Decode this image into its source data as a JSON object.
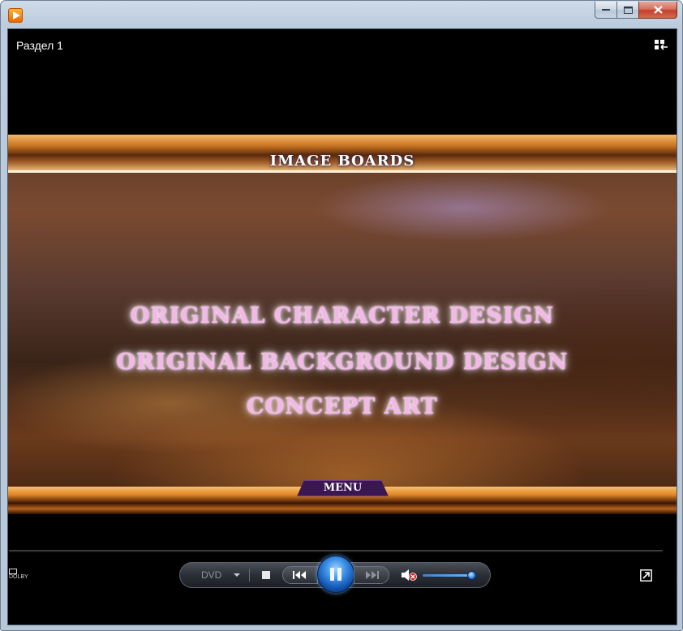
{
  "window": {
    "caption_buttons": [
      "minimize",
      "maximize",
      "close"
    ]
  },
  "header": {
    "chapter": "Раздел 1",
    "switch_icon": "switch-to-library-icon"
  },
  "video": {
    "heading": "IMAGE BOARDS",
    "menu_items": [
      "ORIGINAL CHARACTER DESIGN",
      "ORIGINAL BACKGROUND DESIGN",
      "CONCEPT ART"
    ],
    "menu_tab": "MENU",
    "colors": {
      "menu_text": "#f4b8e8",
      "menu_tab_bg": "#3a1750"
    }
  },
  "controls": {
    "dolby_text": "DOLBY",
    "dvd_label": "DVD",
    "icons": [
      "stop-icon",
      "previous-icon",
      "pause-icon",
      "next-icon",
      "mute-icon",
      "fullscreen-icon"
    ],
    "state": "playing",
    "volume_level": 0.9,
    "muted": true
  }
}
